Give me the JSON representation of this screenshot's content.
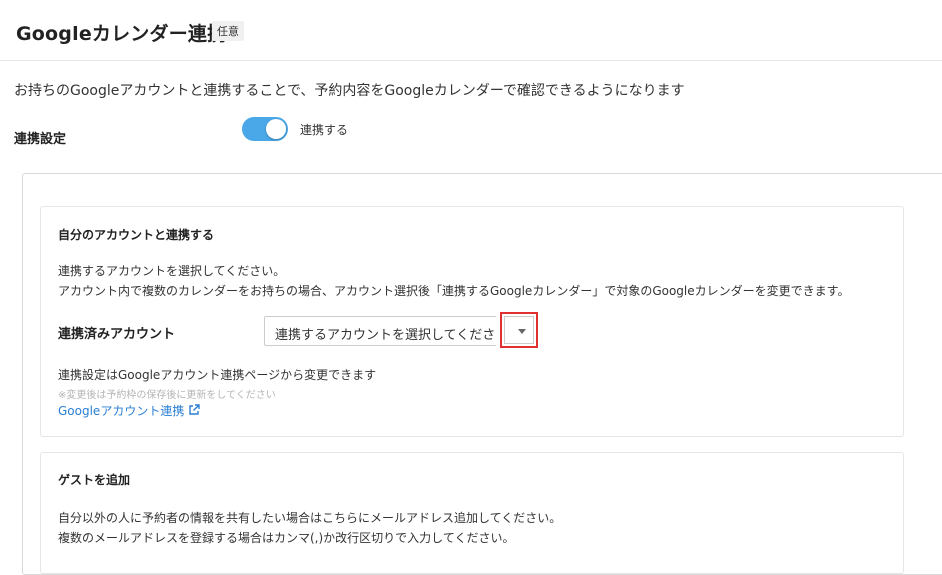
{
  "header": {
    "title": "Googleカレンダー連携",
    "badge": "任意"
  },
  "description": "お持ちのGoogleアカウントと連携することで、予約内容をGoogleカレンダーで確認できるようになります",
  "setting": {
    "label": "連携設定",
    "toggle_label": "連携する",
    "toggle_on": true
  },
  "card_account": {
    "title": "自分のアカウントと連携する",
    "instruction_1": "連携するアカウントを選択してください。",
    "instruction_2": "アカウント内で複数のカレンダーをお持ちの場合、アカウント選択後「連携するGoogleカレンダー」で対象のGoogleカレンダーを変更できます。",
    "linked_account_label": "連携済みアカウント",
    "select_placeholder": "連携するアカウントを選択してください",
    "settings_note": "連携設定はGoogleアカウント連携ページから変更できます",
    "small_note": "※変更後は予約枠の保存後に更新をしてください",
    "link_text": "Googleアカウント連携"
  },
  "card_guest": {
    "title": "ゲストを追加",
    "instruction_1": "自分以外の人に予約者の情報を共有したい場合はこちらにメールアドレス追加してください。",
    "instruction_2": "複数のメールアドレスを登録する場合はカンマ(,)か改行区切りで入力してください。"
  },
  "colors": {
    "accent": "#4aa8e8",
    "link": "#2a7fd4",
    "highlight": "#e03030"
  }
}
